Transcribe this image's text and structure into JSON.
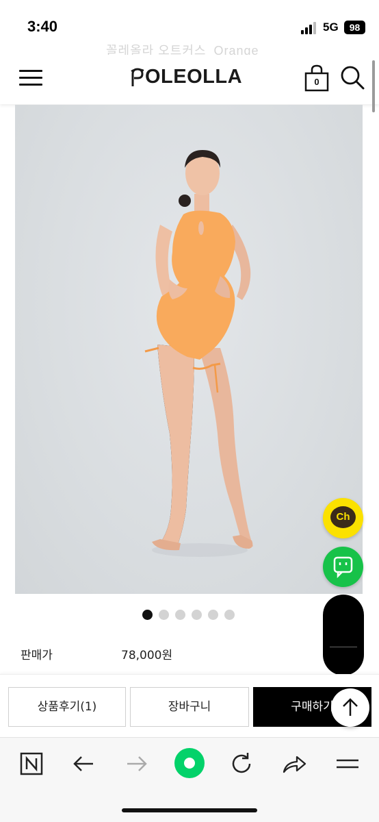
{
  "status_bar": {
    "time": "3:40",
    "network": "5G",
    "battery": "98"
  },
  "header": {
    "faded_scrolled_text": "꼴레올라 오트커스_Orange",
    "logo": "OLEOLLA",
    "cart_count": "0"
  },
  "product": {
    "image_icon": "swimsuit-model-photo",
    "carousel": {
      "total": 6,
      "active": 1
    }
  },
  "price": {
    "label": "판매가",
    "value": "78,000원"
  },
  "actions": {
    "review": "상품후기(1)",
    "cart": "장바구니",
    "buy": "구매하기"
  },
  "floating": {
    "kakao_label": "Ch",
    "kakao_color": "#fbe100",
    "talk_color": "#17c249"
  },
  "colors": {
    "accent_black": "#000000",
    "swimsuit_orange": "#f9aa5c"
  }
}
